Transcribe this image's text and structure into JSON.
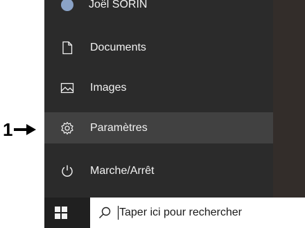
{
  "menu": {
    "items": [
      {
        "label": "Joël SORIN",
        "icon": "user-avatar"
      },
      {
        "label": "Documents",
        "icon": "document-icon"
      },
      {
        "label": "Images",
        "icon": "image-icon"
      },
      {
        "label": "Paramètres",
        "icon": "gear-icon",
        "highlighted": true
      },
      {
        "label": "Marche/Arrêt",
        "icon": "power-icon"
      }
    ]
  },
  "taskbar": {
    "search_placeholder": "Taper ici pour rechercher",
    "start_icon": "windows-logo-icon",
    "search_icon": "search-icon"
  },
  "annotation": {
    "number": "1"
  },
  "colors": {
    "menu_bg": "#2b2b2b",
    "hover_bg": "#414141",
    "taskbar_bg": "#202020",
    "text": "#f2f2f2"
  }
}
